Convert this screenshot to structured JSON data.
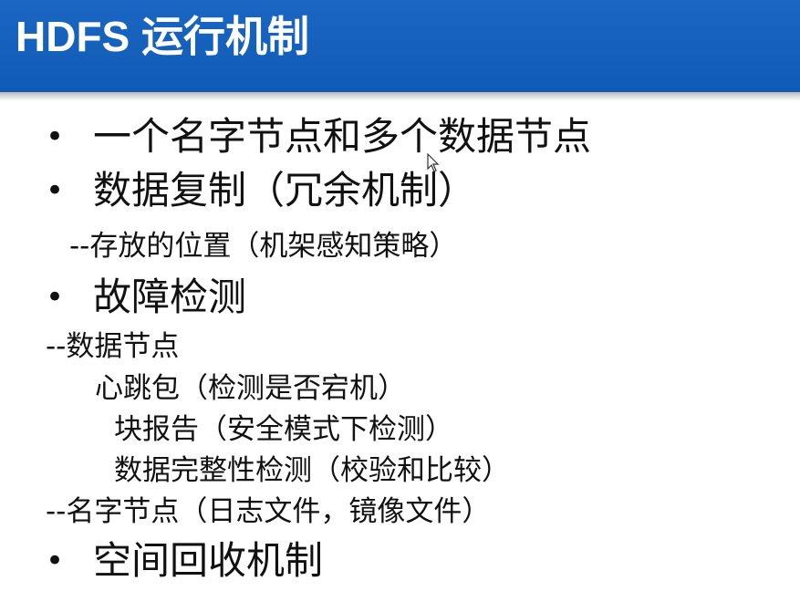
{
  "slide": {
    "title": "HDFS 运行机制"
  },
  "lines": [
    {
      "bullet": "•",
      "text": "一个名字节点和多个数据节点"
    },
    {
      "bullet": "•",
      "text": "数据复制（冗余机制）"
    },
    {
      "text": "--存放的位置（机架感知策略）"
    },
    {
      "bullet": "•",
      "text": "故障检测"
    },
    {
      "text": "--数据节点"
    },
    {
      "text": "心跳包（检测是否宕机）"
    },
    {
      "text": "块报告（安全模式下检测）"
    },
    {
      "text": "数据完整性检测（校验和比较）"
    },
    {
      "text": "--名字节点（日志文件，镜像文件）"
    },
    {
      "bullet": "•",
      "text": "空间回收机制"
    }
  ],
  "colors": {
    "title_bar": "#1a66c2",
    "title_text": "#ffffff",
    "body_text": "#111111"
  },
  "icons": {
    "cursor": "mouse-pointer"
  }
}
